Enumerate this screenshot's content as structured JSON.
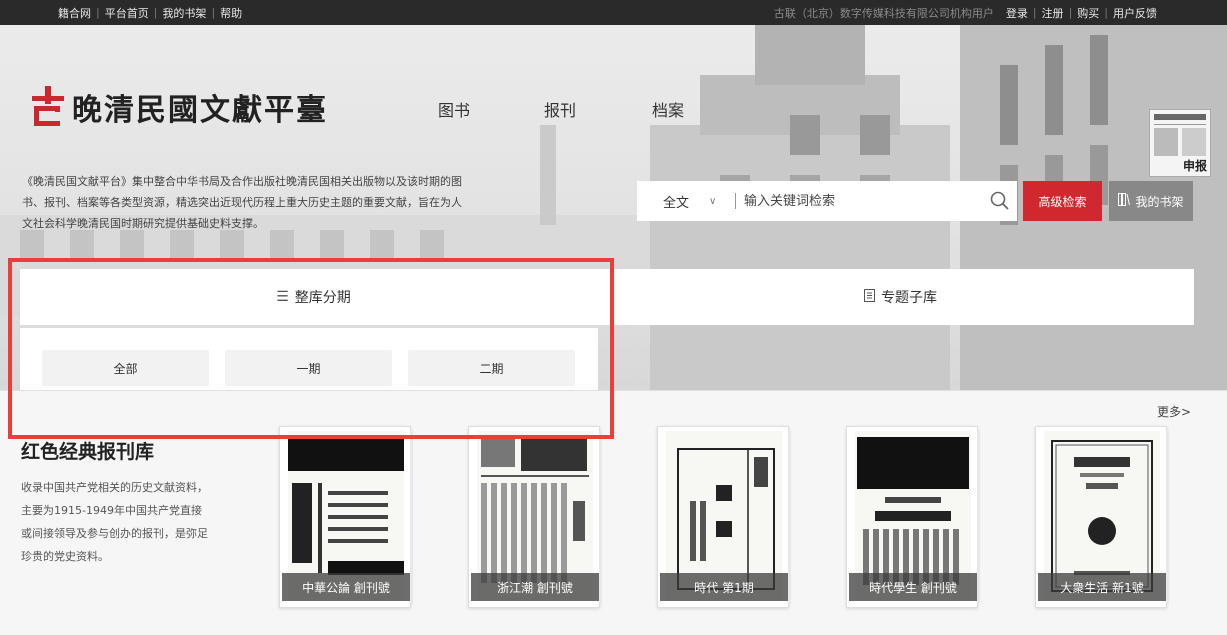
{
  "topbar": {
    "links": [
      "籍合网",
      "平台首页",
      "我的书架",
      "帮助"
    ],
    "org": "古联（北京）数字传媒科技有限公司机构用户",
    "right_links": [
      "登录",
      "注册",
      "购买",
      "用户反馈"
    ]
  },
  "brand": {
    "name": "晚清民國文獻平臺",
    "accent": "#d0282e"
  },
  "nav": [
    "图书",
    "报刊",
    "档案"
  ],
  "description": "《晚清民国文献平台》集中整合中华书局及合作出版社晚清民国相关出版物以及该时期的图书、报刊、档案等各类型资源，精选突出近现代历程上重大历史主题的重要文献，旨在为人文社会科学晚清民国时期研究提供基础史料支撑。",
  "hero_thumb_title": "申报",
  "search": {
    "scope": "全文",
    "placeholder": "输入关键词检索",
    "advanced": "高级检索",
    "shelf": "我的书架"
  },
  "tabs": [
    "整库分期",
    "专题子库"
  ],
  "periods": [
    "全部",
    "一期",
    "二期"
  ],
  "section": {
    "title": "红色经典报刊库",
    "desc": "收录中国共产党相关的历史文献资料，主要为1915-1949年中国共产党直接或间接领导及参与创办的报刊，是弥足珍贵的党史资料。",
    "more": "更多>"
  },
  "cards": [
    {
      "label": "中華公論 創刊號",
      "cover": "中華公論"
    },
    {
      "label": "浙江潮 創刊號",
      "cover": "浙江潮"
    },
    {
      "label": "時代 第1期",
      "cover": "時代"
    },
    {
      "label": "時代學生 創刊號",
      "cover": "時代學生"
    },
    {
      "label": "大衆生活 新1號",
      "cover": "大衆生活"
    }
  ]
}
